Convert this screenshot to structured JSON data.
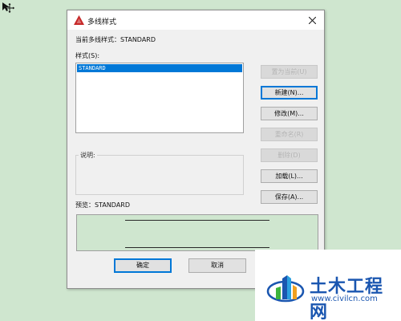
{
  "dialog": {
    "title": "多线样式",
    "current_style_label": "当前多线样式：STANDARD",
    "styles_label": "样式(S):",
    "styles": [
      "STANDARD"
    ],
    "selected_style": "STANDARD",
    "description_label": "说明:",
    "preview_label": "预览：STANDARD",
    "buttons": {
      "set_current": "置为当前(U)",
      "new": "新建(N)...",
      "modify": "修改(M)...",
      "rename": "重命名(R)",
      "delete": "删除(D)",
      "load": "加载(L)...",
      "save": "保存(A)..."
    },
    "ok": "确定",
    "cancel": "取消"
  },
  "watermark": {
    "title": "土木工程网",
    "url": "www.civilcn.com"
  },
  "colors": {
    "selection": "#0078d7",
    "app_icon": "#c62828",
    "brand_blue": "#1a56b0",
    "canvas": "#cfe6cf"
  }
}
